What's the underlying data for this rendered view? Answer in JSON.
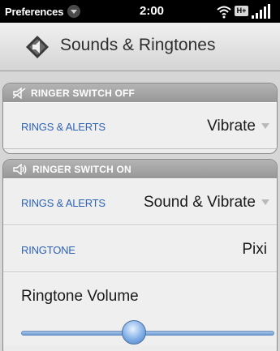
{
  "status_bar": {
    "app_menu": "Preferences",
    "time": "2:00",
    "network": "H+"
  },
  "header": {
    "title": "Sounds & Ringtones",
    "icon": "speaker-icon"
  },
  "ringer_off": {
    "heading": "RINGER SWITCH OFF",
    "icon": "muted-speaker-icon",
    "rings_alerts_label": "RINGS & ALERTS",
    "rings_alerts_value": "Vibrate"
  },
  "ringer_on": {
    "heading": "RINGER SWITCH ON",
    "icon": "speaker-on-icon",
    "rings_alerts_label": "RINGS & ALERTS",
    "rings_alerts_value": "Sound & Vibrate",
    "ringtone_label": "RINGTONE",
    "ringtone_value": "Pixi",
    "volume_label": "Ringtone Volume",
    "volume_level": 0.44
  },
  "colors": {
    "label_blue": "#2e62b5",
    "slider_blue": "#6c9bd3"
  }
}
